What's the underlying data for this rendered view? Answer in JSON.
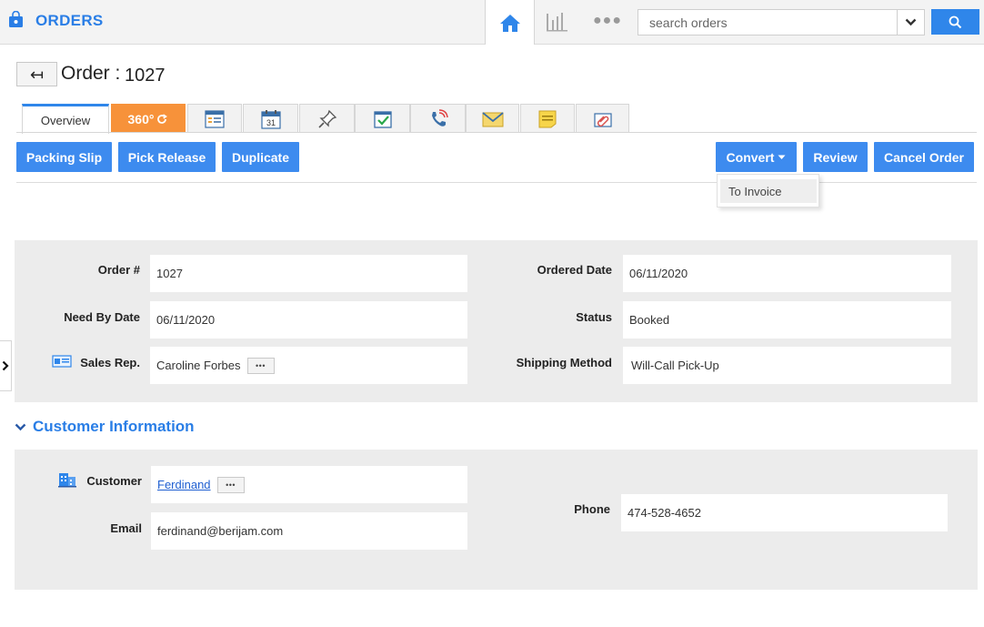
{
  "header": {
    "app_title": "ORDERS",
    "search_placeholder": "search orders",
    "more_glyph": "●●●"
  },
  "title": {
    "label": "Order :",
    "number": "1027",
    "back_glyph": "↤"
  },
  "tabs": [
    {
      "id": "overview",
      "label": "Overview",
      "active": true
    },
    {
      "id": "360",
      "label": "360°",
      "icon": "refresh-icon"
    },
    {
      "id": "details",
      "icon": "list-document-icon"
    },
    {
      "id": "calendar",
      "icon": "calendar-icon",
      "day": "31"
    },
    {
      "id": "pin",
      "icon": "pin-icon"
    },
    {
      "id": "tasks",
      "icon": "checkbox-icon"
    },
    {
      "id": "calls",
      "icon": "phone-icon"
    },
    {
      "id": "emails",
      "icon": "envelope-icon"
    },
    {
      "id": "notes",
      "icon": "note-icon"
    },
    {
      "id": "attachments",
      "icon": "paperclip-icon"
    }
  ],
  "actions": {
    "packing_slip": "Packing Slip",
    "pick_release": "Pick Release",
    "duplicate": "Duplicate",
    "convert": "Convert",
    "review": "Review",
    "cancel_order": "Cancel Order",
    "convert_menu": [
      "To Invoice"
    ]
  },
  "order_fields": {
    "order_no_label": "Order #",
    "order_no_value": "1027",
    "ordered_date_label": "Ordered Date",
    "ordered_date_value": "06/11/2020",
    "need_by_label": "Need By Date",
    "need_by_value": "06/11/2020",
    "status_label": "Status",
    "status_value": "Booked",
    "sales_rep_label": "Sales Rep.",
    "sales_rep_value": "Caroline Forbes",
    "shipping_label": "Shipping Method",
    "shipping_value": "Will-Call Pick-Up",
    "mini_btn_glyph": "•••"
  },
  "customer_section": {
    "title": "Customer Information",
    "customer_label": "Customer",
    "customer_value": "Ferdinand",
    "email_label": "Email",
    "email_value": "ferdinand@berijam.com",
    "phone_label": "Phone",
    "phone_value": "474-528-4652"
  },
  "colors": {
    "accent": "#2f86ea",
    "title_blue": "#2a7ee6",
    "tab_360": "#f7923a",
    "panel_bg": "#ececec"
  }
}
